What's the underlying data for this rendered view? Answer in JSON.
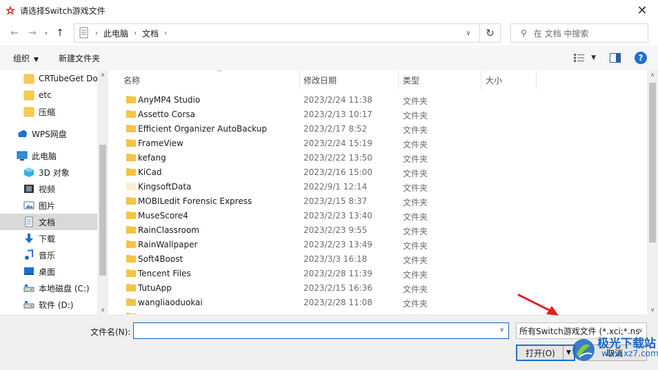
{
  "window": {
    "title": "请选择Switch游戏文件",
    "close_glyph": "✕"
  },
  "nav": {
    "breadcrumb": [
      "此电脑",
      "文档"
    ],
    "search_placeholder": "在 文档 中搜索"
  },
  "toolbar": {
    "organize_label": "组织",
    "new_folder_label": "新建文件夹"
  },
  "sidebar": {
    "items": [
      {
        "label": "CRTubeGet Do",
        "icon": "folder-icon"
      },
      {
        "label": "etc",
        "icon": "folder-icon"
      },
      {
        "label": "压缩",
        "icon": "folder-icon"
      },
      {
        "label": "WPS网盘",
        "icon": "cloud-icon"
      },
      {
        "label": "此电脑",
        "icon": "computer-icon"
      },
      {
        "label": "3D 对象",
        "icon": "cube-icon"
      },
      {
        "label": "视频",
        "icon": "video-icon"
      },
      {
        "label": "图片",
        "icon": "picture-icon"
      },
      {
        "label": "文档",
        "icon": "document-icon",
        "selected": true
      },
      {
        "label": "下载",
        "icon": "download-icon"
      },
      {
        "label": "音乐",
        "icon": "music-icon"
      },
      {
        "label": "桌面",
        "icon": "desktop-icon"
      },
      {
        "label": "本地磁盘 (C:)",
        "icon": "drive-icon"
      },
      {
        "label": "软件 (D:)",
        "icon": "drive-icon"
      }
    ]
  },
  "filelist": {
    "columns": {
      "name": "名称",
      "date": "修改日期",
      "type": "类型",
      "size": "大小"
    },
    "rows": [
      {
        "name": "AnyMP4 Studio",
        "date": "2023/2/24 11:38",
        "type": "文件夹"
      },
      {
        "name": "Assetto Corsa",
        "date": "2023/2/13 10:17",
        "type": "文件夹"
      },
      {
        "name": "Efficient Organizer AutoBackup",
        "date": "2023/2/17 8:52",
        "type": "文件夹"
      },
      {
        "name": "FrameView",
        "date": "2023/2/24 15:19",
        "type": "文件夹"
      },
      {
        "name": "kefang",
        "date": "2023/2/22 13:50",
        "type": "文件夹"
      },
      {
        "name": "KiCad",
        "date": "2023/2/16 15:00",
        "type": "文件夹"
      },
      {
        "name": "KingsoftData",
        "date": "2022/9/1 12:14",
        "type": "文件夹",
        "pale": true
      },
      {
        "name": "MOBILedit Forensic Express",
        "date": "2023/2/15 8:37",
        "type": "文件夹"
      },
      {
        "name": "MuseScore4",
        "date": "2023/2/23 13:40",
        "type": "文件夹"
      },
      {
        "name": "RainClassroom",
        "date": "2023/2/23 9:55",
        "type": "文件夹"
      },
      {
        "name": "RainWallpaper",
        "date": "2023/2/23 13:49",
        "type": "文件夹"
      },
      {
        "name": "Soft4Boost",
        "date": "2023/3/3 16:18",
        "type": "文件夹"
      },
      {
        "name": "Tencent Files",
        "date": "2023/2/28 11:39",
        "type": "文件夹"
      },
      {
        "name": "TutuApp",
        "date": "2023/2/15 16:36",
        "type": "文件夹"
      },
      {
        "name": "wangliaoduokai",
        "date": "2023/2/28 11:08",
        "type": "文件夹"
      },
      {
        "name": "",
        "date": "",
        "type": "文件夹"
      }
    ]
  },
  "bottom": {
    "filename_label": "文件名(N):",
    "filename_value": "",
    "filter_value": "所有Switch游戏文件 (*.xci;*.ns",
    "open_label": "打开(O)",
    "cancel_label": "取消"
  },
  "watermark": {
    "text_top": "极光下载站",
    "text_bottom": "www.xz7.com"
  },
  "colors": {
    "accent": "#1f6fd0",
    "folder": "#f6c343",
    "arrow": "#e02020"
  }
}
